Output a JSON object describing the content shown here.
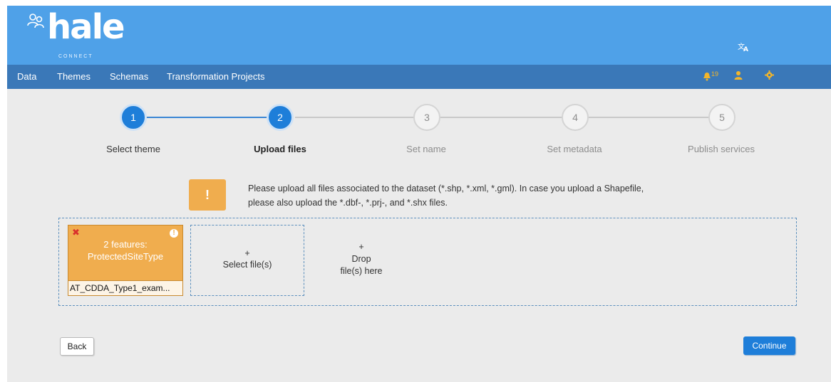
{
  "header": {
    "logo_text": "hale",
    "logo_sub": "CONNECT",
    "translate_icon": "translate-icon"
  },
  "nav": {
    "items": [
      "Data",
      "Themes",
      "Schemas",
      "Transformation Projects"
    ],
    "notifications_count": "19"
  },
  "steps": [
    {
      "number": "1",
      "label": "Select theme",
      "state": "done"
    },
    {
      "number": "2",
      "label": "Upload files",
      "state": "current"
    },
    {
      "number": "3",
      "label": "Set name",
      "state": "pending"
    },
    {
      "number": "4",
      "label": "Set metadata",
      "state": "pending"
    },
    {
      "number": "5",
      "label": "Publish services",
      "state": "pending"
    }
  ],
  "info": {
    "icon": "!",
    "line1": "Please upload all files associated to the dataset (*.shp, *.xml, *.gml). In case you upload a Shapefile,",
    "line2": "please also upload the *.dbf-, *.prj-, and *.shx files."
  },
  "upload": {
    "file": {
      "features_line1": "2 features:",
      "features_line2": "ProtectedSiteType",
      "name": "AT_CDDA_Type1_exam..."
    },
    "select": {
      "plus": "+",
      "label": "Select file(s)"
    },
    "drop": {
      "plus": "+",
      "line1": "Drop",
      "line2": "file(s) here"
    }
  },
  "buttons": {
    "back": "Back",
    "continue": "Continue"
  },
  "colors": {
    "primary": "#1e7ed9",
    "warning": "#f0ad4e",
    "header": "#4fa1e8",
    "nav": "#3a78b8"
  }
}
